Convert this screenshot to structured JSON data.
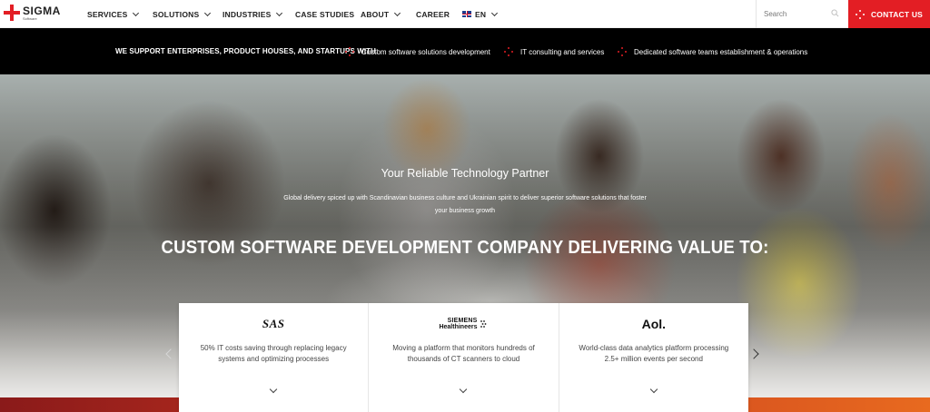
{
  "brand": {
    "name": "SIGMA",
    "sub": "Software",
    "accent": "#e31e24"
  },
  "nav": {
    "items": [
      {
        "label": "SERVICES",
        "dropdown": true
      },
      {
        "label": "SOLUTIONS",
        "dropdown": true
      },
      {
        "label": "INDUSTRIES",
        "dropdown": true
      },
      {
        "label": "CASE STUDIES",
        "dropdown": false
      },
      {
        "label": "ABOUT",
        "dropdown": true
      },
      {
        "label": "CAREER",
        "dropdown": false
      },
      {
        "label": "EN",
        "dropdown": true,
        "icon": "uk-flag-icon"
      }
    ],
    "search": {
      "placeholder": "Search",
      "icon": "search-icon"
    },
    "contact": {
      "label": "CONTACT US",
      "icon": "dots-icon"
    }
  },
  "support": {
    "lead": "WE SUPPORT ENTERPRISES, PRODUCT HOUSES, AND STARTUPS WITH:",
    "items": [
      "Custom software solutions development",
      "IT consulting and services",
      "Dedicated software teams establishment & operations"
    ]
  },
  "hero": {
    "tagline": "Your Reliable Technology Partner",
    "subtext": "Global delivery spiced up with Scandinavian business culture and Ukrainian spirit to deliver superior software solutions that foster your business growth",
    "headline": "CUSTOM SOFTWARE DEVELOPMENT COMPANY DELIVERING VALUE TO:"
  },
  "cases": [
    {
      "logo": "SAS",
      "text": "50% IT costs saving through replacing legacy systems and optimizing processes"
    },
    {
      "logo_line1": "SIEMENS",
      "logo_line2": "Healthineers",
      "text": "Moving a platform that monitors hundreds of thousands of CT scanners to cloud"
    },
    {
      "logo": "Aol.",
      "text": "World-class data analytics platform processing 2.5+ million events per second"
    }
  ]
}
